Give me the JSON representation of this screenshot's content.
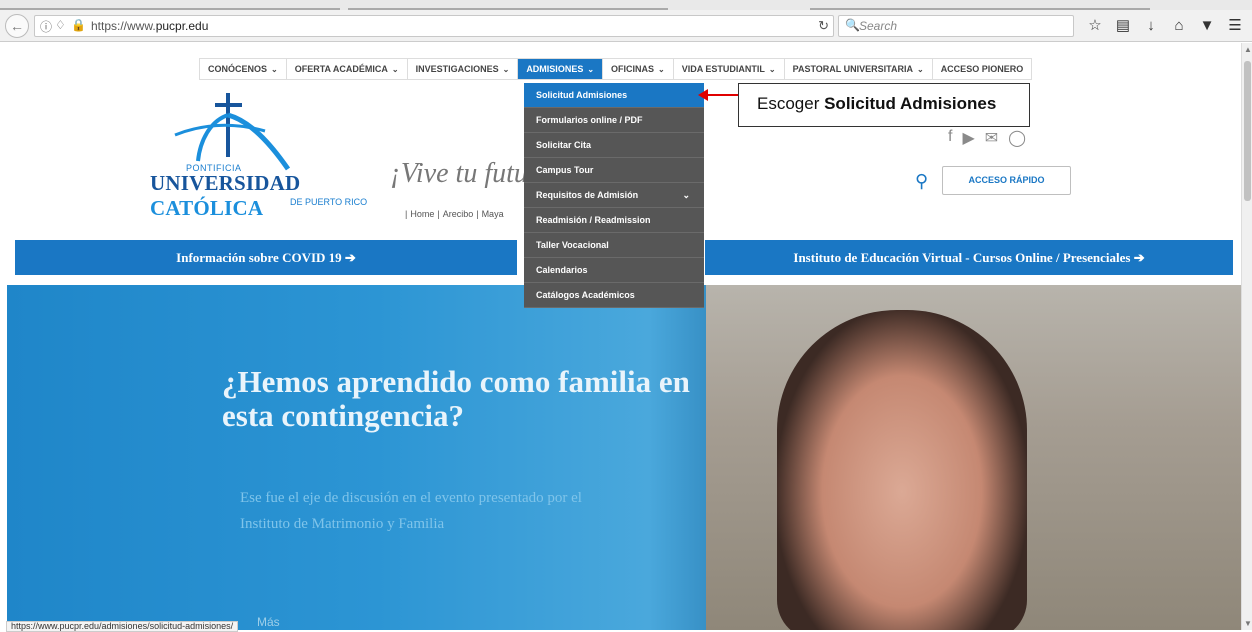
{
  "browser": {
    "url_prefix": "https://www.",
    "url_domain": "pucpr.edu",
    "search_placeholder": "Search",
    "status_url": "https://www.pucpr.edu/admisiones/solicitud-admisiones/"
  },
  "nav": {
    "items": [
      {
        "label": "CONÓCENOS"
      },
      {
        "label": "OFERTA ACADÉMICA"
      },
      {
        "label": "INVESTIGACIONES"
      },
      {
        "label": "ADMISIONES"
      },
      {
        "label": "OFICINAS"
      },
      {
        "label": "VIDA ESTUDIANTIL"
      },
      {
        "label": "PASTORAL UNIVERSITARIA"
      },
      {
        "label": "ACCESO PIONERO"
      }
    ]
  },
  "dropdown": {
    "items": [
      {
        "label": "Solicitud Admisiones"
      },
      {
        "label": "Formularios online / PDF"
      },
      {
        "label": "Solicitar Cita"
      },
      {
        "label": "Campus Tour"
      },
      {
        "label": "Requisitos de Admisión"
      },
      {
        "label": "Readmisión / Readmission"
      },
      {
        "label": "Taller Vocacional"
      },
      {
        "label": "Calendarios"
      },
      {
        "label": "Catálogos Académicos"
      }
    ]
  },
  "callout": {
    "prefix": "Escoger ",
    "bold": "Solicitud Admisiones"
  },
  "logo": {
    "pontificia": "PONTIFICIA",
    "name_left": "UNIVERSIDAD ",
    "name_right": "CATÓLICA",
    "sub": "DE PUERTO RICO"
  },
  "header": {
    "tagline": "¡Vive tu futuro",
    "campus": [
      "Home",
      "Arecibo",
      "Maya"
    ],
    "acceso_label": "ACCESO RÁPIDO"
  },
  "banners": {
    "left": "Información sobre COVID 19",
    "right": "Instituto de Educación Virtual - Cursos Online / Presenciales"
  },
  "hero": {
    "title": "¿Hemos aprendido como familia en esta contingencia?",
    "sub": "Ese fue el eje de discusión en el evento presentado por el Instituto de Matrimonio y Familia",
    "more": "Más"
  },
  "colors": {
    "brand_blue": "#1a77c4",
    "dropdown_bg": "#565656",
    "arrow_red": "#e00000"
  }
}
